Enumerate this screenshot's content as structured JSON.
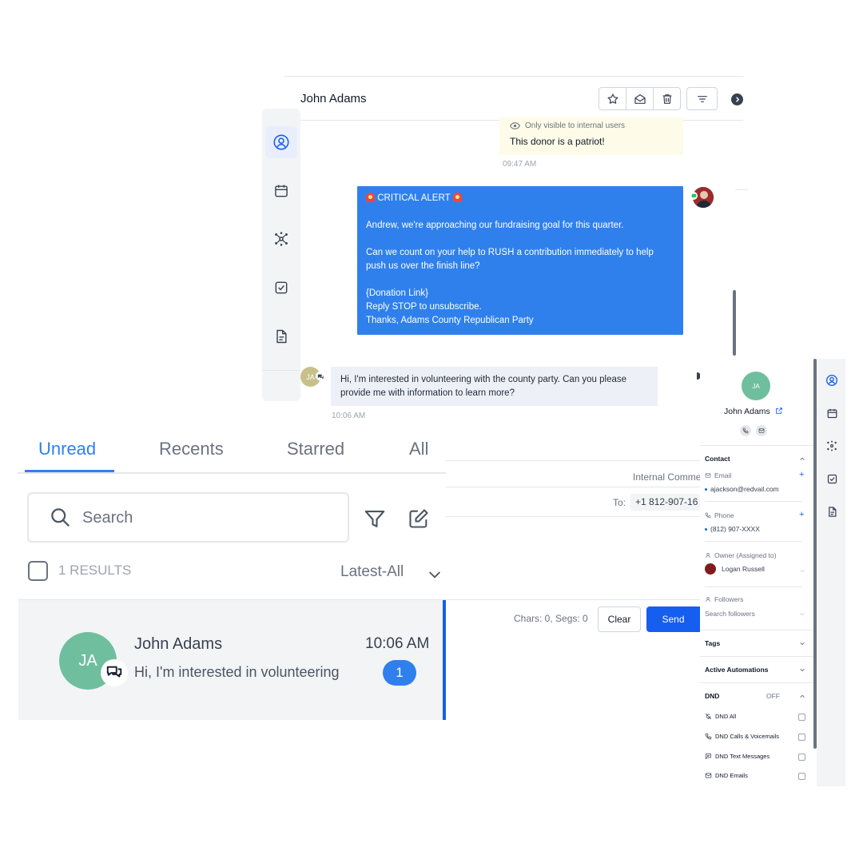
{
  "conversation": {
    "title": "John Adams",
    "note": {
      "visibility": "Only visible to internal users",
      "text": "This donor is a patriot!",
      "time": "09:47 AM"
    },
    "outgoing": {
      "heading": "CRITICAL ALERT",
      "line1": "Andrew, we're approaching our fundraising goal for this quarter.",
      "line2": "Can we count on your help to RUSH a contribution immediately to help push us over the finish line?",
      "line3": "{Donation Link}",
      "line4": "Reply STOP to unsubscribe.",
      "line5": "Thanks, Adams County Republican Party"
    },
    "incoming": {
      "initials": "JA",
      "text": "Hi, I'm interested in volunteering with the county party. Can you please provide me with information to learn more?",
      "time": "10:06 AM"
    }
  },
  "composer": {
    "internal_label": "Internal Comme",
    "to_label": "To:",
    "to_number": "+1 812-907-16",
    "counter": "Chars: 0, Segs: 0",
    "clear_label": "Clear",
    "send_label": "Send"
  },
  "inbox": {
    "tabs": [
      "Unread",
      "Recents",
      "Starred",
      "All"
    ],
    "active_tab": "Unread",
    "search_placeholder": "Search",
    "results": "1 RESULTS",
    "sort": "Latest-All",
    "item": {
      "initials": "JA",
      "name": "John Adams",
      "time": "10:06 AM",
      "preview": "Hi, I'm interested in volunteering",
      "unread": "1"
    }
  },
  "contact": {
    "initials": "JA",
    "name": "John Adams",
    "contact_heading": "Contact",
    "email_label": "Email",
    "email": "ajackson@redvail.com",
    "phone_label": "Phone",
    "phone": "(812) 907-XXXX",
    "owner_label": "Owner (Assigned to)",
    "owner": "Logan Russell",
    "followers_label": "Followers",
    "followers_placeholder": "Search followers",
    "tags_heading": "Tags",
    "automations_heading": "Active Automations",
    "dnd_heading": "DND",
    "dnd_state": "OFF",
    "dnd_items": [
      "DND All",
      "DND Calls & Voicemails",
      "DND Text Messages",
      "DND Emails"
    ]
  },
  "colors": {
    "accent": "#155eef",
    "bubble_blue": "#2f80ed",
    "avatar_green": "#6fbf9f",
    "note_yellow": "#fefce8"
  }
}
